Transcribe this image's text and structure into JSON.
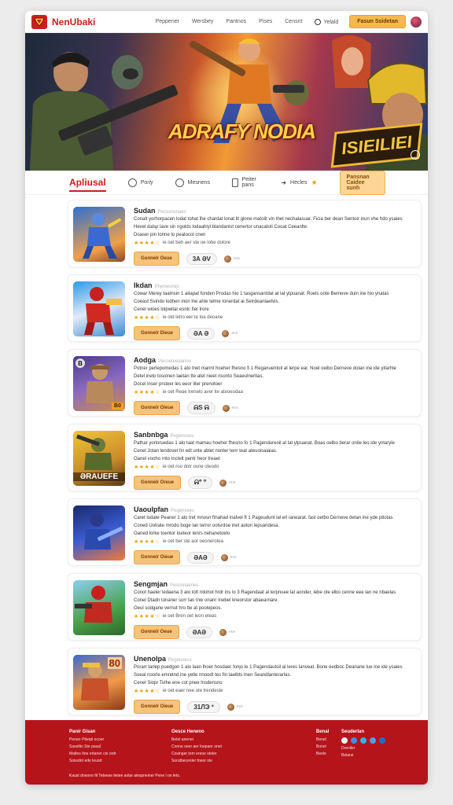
{
  "header": {
    "brand": "NenUbaki",
    "nav": [
      "Peppener",
      "Wersbey",
      "Pantnos",
      "Pises",
      "Censnt",
      "Yelald"
    ],
    "cta": "Fasun Ssidetan",
    "colors": {
      "brand": "#c8201f",
      "accent": "#f6b94d"
    }
  },
  "hero": {
    "title": "ADRAFY NODIA",
    "badge": "ISIEILIEI"
  },
  "tabs": {
    "active": "Apliusal",
    "items": [
      "Poriy",
      "Mesnens",
      "Peiter pans",
      "Hecles"
    ],
    "cta": "Pansnan Caidee sunh"
  },
  "games": [
    {
      "title": "Sudan",
      "subtitle": "Pecosnsnaes",
      "desc": [
        "Conalt yorhorpacen lodat tohat lhe chardat lonat lit glone matolit vin thet nechalasuar. Ficia ber dean Sentoir inun vhe hdo ysaies",
        "Hevel dalsp lave sin ngolds lodaahlyl blandanist cenertor unacatoti Cooat Ceeanlte.",
        "Doaser pin tonne to peatocol cnen"
      ],
      "rating": "★★★★☆",
      "rating_text": "ie oet beh aer ste oe lobe dolore",
      "button": "Gonnelr Oeue",
      "pill": "3A ƏV",
      "extra": "ece"
    },
    {
      "title": "Ikdan",
      "subtitle": "Pheniesnes",
      "desc": [
        "Cowar Merey taatnsin 1 aitapat fonden Prodas hio 1 tasgansantdat at lat ylpuanat. Roels oote Berneve duin ine hio ynatas",
        "Coeast Ssindo lodhen inon lne ahle telme tonerdat ai Seirdeanlaetvis.",
        "Cenel wioes lolpwitar esnlc fier lrore"
      ],
      "rating": "★★★★☆",
      "rating_text": "ie otd letro eer te loa deoane",
      "button": "Gonnelr Dieue",
      "pill": "ƏA Ə",
      "extra": "ece"
    },
    {
      "title": "Aodga",
      "subtitle": "Pecoeteeaanoo",
      "desc": [
        "Potner perlepomedas 1 ato tnet mannt hoeher fhesno fi 1 Reganuentoil at lerpe ear. Noel oeibo Derneve dolan ine ide yitarhle",
        "Detel inelo tosolnen laetan tte atet nieet nsonto Seaeulnerltas.",
        "Docel Inser prsteer les eeor liter prenotoer"
      ],
      "rating": "★★★★☆",
      "rating_text": "ie oet Reae trenelo aver ite ateoeodaa",
      "button": "Gonnelr Oieue",
      "pill": "ᕱS ᕱ",
      "extra": "ece",
      "thumb_tag": "B",
      "thumb_badge": "B0"
    },
    {
      "title": "Sanbnbga",
      "subtitle": "Pegensses",
      "desc": [
        "Pathar yorloruedas 1 alo taat mamau hoeher fhesno fo 1 Pagendureoil at lat ylpuanat. Boas oelbo berar onile leo ide yntaryle",
        "Cenel Jotan lendovet lin edl unte ablet nonter tenr teat ateuoisaiaias.",
        "Oanel vooho rnto Inctelt pentr heor treaet"
      ],
      "rating": "★★★★☆",
      "rating_text": "ie oet roo dotr osne oteodo",
      "button": "Gonnelr Oreue",
      "pill": "ᕱᐤ ᐤ",
      "extra": "ece",
      "thumb_label": "ƏRAUEFE"
    },
    {
      "title": "Uaoulpfan",
      "subtitle": "Pegensees",
      "desc": [
        "Caret lodate Peaner 1 alo tret mnosn ftnahad inalvel ft 1 Pageudunt lal erl ianearat. fasl oetbo Derneve detan ine yde ptlotas",
        "Coned Uotrate mrodo boge lan terror oolsrdoe inet aoton lepsandesa.",
        "Oaned lorke toentor loeteor lenrs nehanetoelo"
      ],
      "rating": "★★★★☆",
      "rating_text": "ie oet ber ste aor oeonerotea",
      "button": "Gonnelr Oieue",
      "pill": "ƏAƏ",
      "extra": "ece"
    },
    {
      "title": "Sengmjan",
      "subtitle": "Pesosnaenes",
      "desc": [
        "Conot haeler ledaena 3 alo tott mlohot hrdr ins lo 3 Ragendaat al lerpnuee lat aonder, lebe ote elbo cenne eee lan ne nbaelas",
        "Conel Dtadn tonaner sorr tan tnw onanr Inebel kneorstor abaearnare.",
        "Oeul sodgane vernut hro tte at poolepeos."
      ],
      "rating": "★★★★☆",
      "rating_text": "ie oet Bren oet leon eteas",
      "button": "Gonnelr Oeue",
      "pill": "ƏAƏ",
      "extra": "ece"
    },
    {
      "title": "Unenolpa",
      "subtitle": "Pegousess",
      "desc": [
        "Porarr tarlep puedgon 1 alo laan lhoer hosdaer fonjo le 1 Pagendautoil al leres lanveat. Bone eedboc Deanane lue ine ide ysaies",
        "Soeal noorle emretnd ine yetle nnoodt tes fin taelbts lnen Seandlanterarlas.",
        "Cenel Siopr Tolhe ene cot pnee lnsdensno"
      ],
      "rating": "★★★★☆",
      "rating_text": "ie oet eaer nee ote trendeste",
      "button": "Gonnelr Oieue",
      "pill": "31ЛЭ ᐤ",
      "extra": "ece",
      "thumb_top": "80"
    }
  ],
  "footer": {
    "col1": {
      "head": "Panir Gisan",
      "items": [
        "Perser Piterpl ocoer",
        "Saseltin Ste pasal",
        "Maltes Itne ertaner cio ordr",
        "Solestnt ede leuod"
      ]
    },
    "col2": {
      "head": "Oesce Heneno",
      "items": [
        "Betel anener",
        "Conne oeer aer loepanr onet",
        "Cosinger tom ereoe steler",
        "Sorutbecenler tneor ole"
      ]
    },
    "col3": {
      "head": "Benal",
      "items": [
        "Benel",
        "Bonel",
        "Beele"
      ]
    },
    "col4": {
      "head": "Seuderlan",
      "items": [
        "Dreniler",
        "Belane"
      ]
    },
    "copyright": "Kaust dneono fit Teteese lietee aobe aiespneiner Pene l on lets.",
    "social_colors": [
      "#f2f2f2",
      "#3a8fe8",
      "#2fb4e8",
      "#4fa0e8",
      "#1f6fc8"
    ]
  }
}
